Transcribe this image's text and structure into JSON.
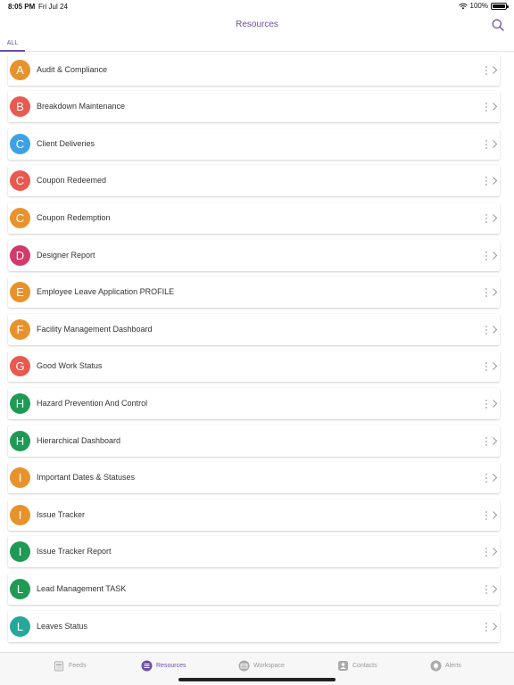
{
  "status_bar": {
    "time": "8:05 PM",
    "date": "Fri Jul 24",
    "battery": "100%"
  },
  "header": {
    "title": "Resources"
  },
  "tabs": {
    "all_label": "ALL"
  },
  "colors": {
    "accent": "#6b4fa8",
    "orange": "#e8922c",
    "red": "#e85a4f",
    "blue": "#3ea1e6",
    "crimson": "#d23a6a",
    "green": "#1f9a55"
  },
  "resources": [
    {
      "letter": "A",
      "name": "Audit & Compliance",
      "color": "#e8922c"
    },
    {
      "letter": "B",
      "name": "Breakdown Maintenance",
      "color": "#e85a4f"
    },
    {
      "letter": "C",
      "name": "Client Deliveries",
      "color": "#3ea1e6"
    },
    {
      "letter": "C",
      "name": "Coupon Redeemed",
      "color": "#e85a4f"
    },
    {
      "letter": "C",
      "name": "Coupon Redemption",
      "color": "#e8922c"
    },
    {
      "letter": "D",
      "name": "Designer Report",
      "color": "#d23a6a"
    },
    {
      "letter": "E",
      "name": "Employee Leave Application PROFILE",
      "color": "#e8922c"
    },
    {
      "letter": "F",
      "name": "Facility Management Dashboard",
      "color": "#e8922c"
    },
    {
      "letter": "G",
      "name": "Good Work Status",
      "color": "#e85a4f"
    },
    {
      "letter": "H",
      "name": "Hazard Prevention And Control",
      "color": "#1f9a55"
    },
    {
      "letter": "H",
      "name": "Hierarchical Dashboard",
      "color": "#1f9a55"
    },
    {
      "letter": "I",
      "name": "Important Dates & Statuses",
      "color": "#e8922c"
    },
    {
      "letter": "I",
      "name": "Issue Tracker",
      "color": "#e8922c"
    },
    {
      "letter": "I",
      "name": "Issue Tracker Report",
      "color": "#1f9a55"
    },
    {
      "letter": "L",
      "name": "Lead Management TASK",
      "color": "#1f9a55"
    },
    {
      "letter": "L",
      "name": "Leaves Status",
      "color": "#25a89a"
    }
  ],
  "tab_bar": {
    "feeds": "Feeds",
    "resources": "Resources",
    "workspace": "Workspace",
    "contacts": "Contacts",
    "alerts": "Alerts"
  },
  "icons": {
    "search": "search-icon",
    "more": "more-vertical-icon",
    "chevron": "chevron-right-icon",
    "feeds": "feeds-icon",
    "resources": "resources-icon",
    "workspace": "workspace-icon",
    "contacts": "contacts-icon",
    "alerts": "bell-icon"
  }
}
